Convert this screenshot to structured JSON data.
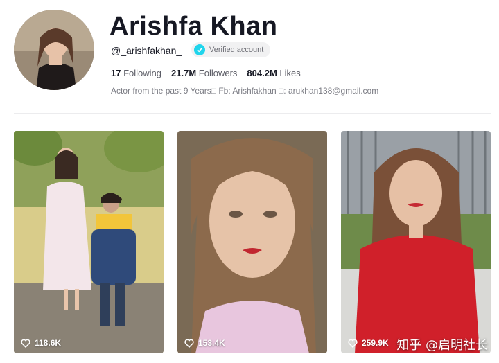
{
  "profile": {
    "name": "Arishfa Khan",
    "handle": "@_arishfakhan_",
    "verified_label": "Verified account",
    "stats": {
      "following_count": "17",
      "following_label": "Following",
      "followers_count": "21.7M",
      "followers_label": "Followers",
      "likes_count": "804.2M",
      "likes_label": "Likes"
    },
    "bio": "Actor from the past 9 Years□ Fb: Arishfakhan □: arukhan138@gmail.com"
  },
  "videos": [
    {
      "likes": "118.6K"
    },
    {
      "likes": "153.4K"
    },
    {
      "likes": "259.9K"
    }
  ],
  "watermark": "知乎 @启明社长",
  "colors": {
    "verified_badge": "#20d5ec",
    "text_primary": "#161823",
    "text_secondary": "#7a7b83"
  }
}
